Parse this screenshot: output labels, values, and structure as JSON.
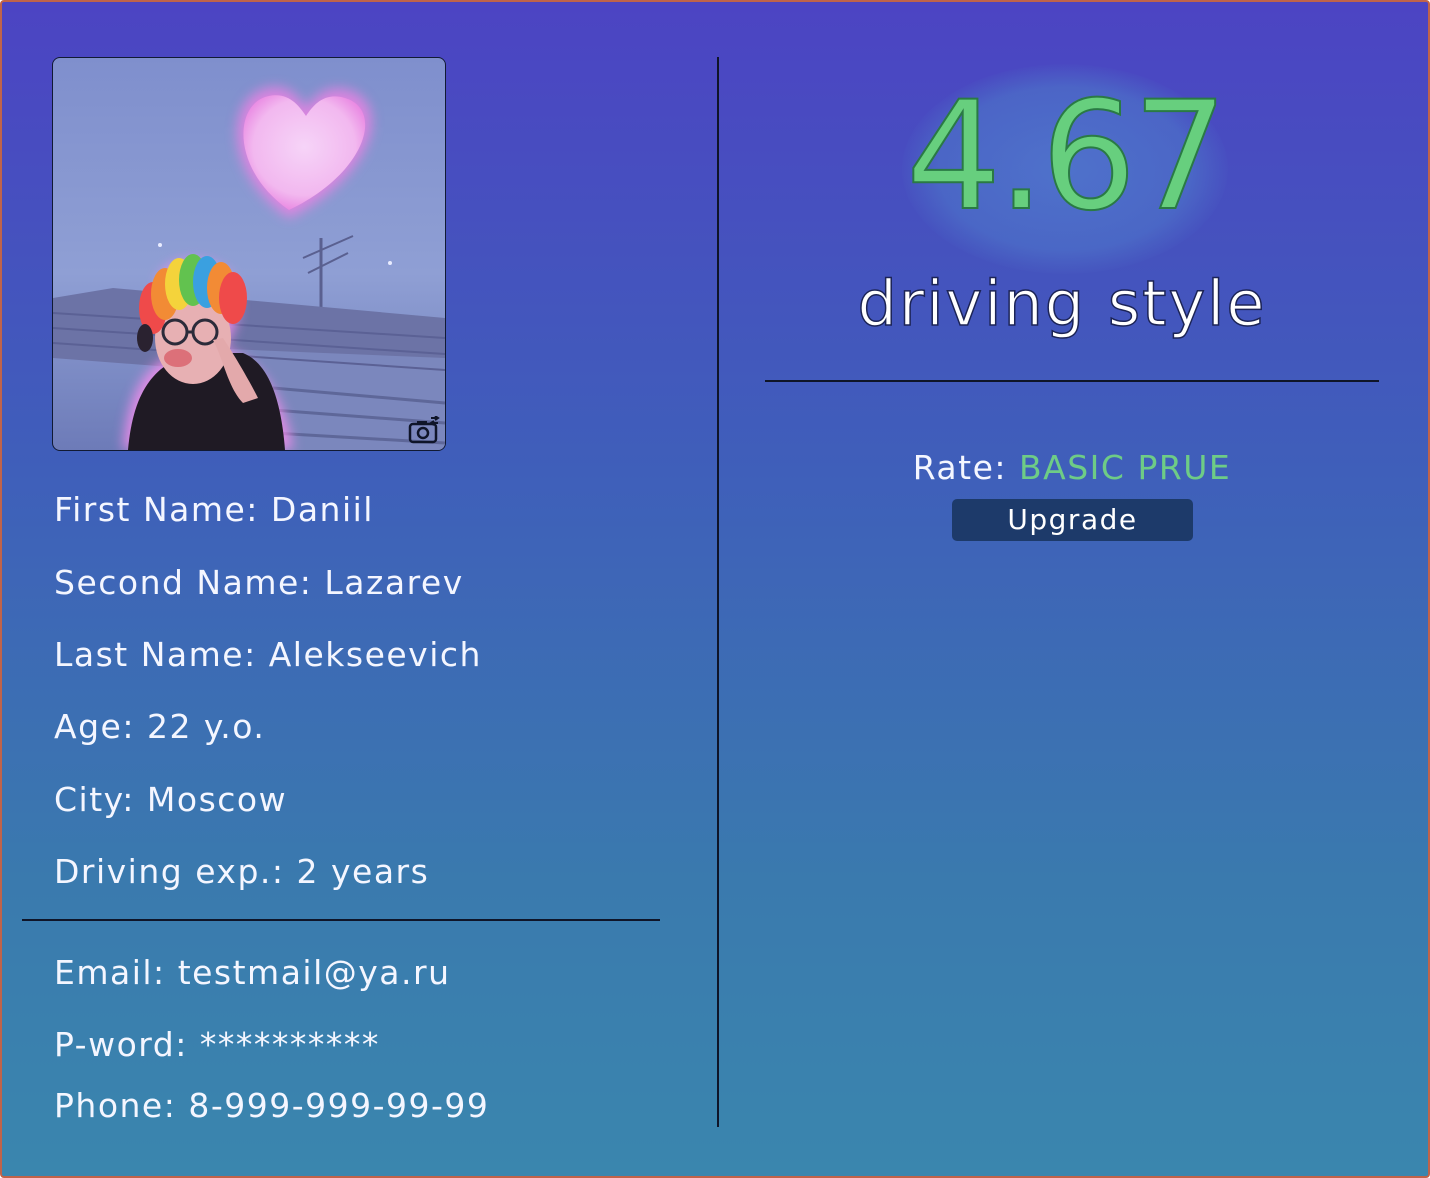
{
  "profile": {
    "avatar_alt": "profile photo",
    "fields": [
      {
        "label": "First Name:",
        "value": "Daniil"
      },
      {
        "label": "Second Name:",
        "value": "Lazarev"
      },
      {
        "label": "Last Name:",
        "value": "Alekseevich"
      },
      {
        "label": "Age:",
        "value": "22 y.o."
      },
      {
        "label": "City:",
        "value": "Moscow"
      },
      {
        "label": "Driving exp.:",
        "value": "2 years"
      }
    ],
    "account": [
      {
        "label": "Email:",
        "value": "testmail@ya.ru"
      },
      {
        "label": "P-word:",
        "value": "**********"
      },
      {
        "label": "Phone:",
        "value": "8-999-999-99-99"
      }
    ]
  },
  "score": {
    "value": "4.67",
    "caption": "driving style"
  },
  "rate": {
    "label": "Rate:",
    "plan": "BASIC PRUE",
    "upgrade_label": "Upgrade"
  },
  "icons": {
    "change_photo": "camera-switch-icon"
  },
  "colors": {
    "accent_green": "#67cf7e",
    "button_bg": "#1d3a6a",
    "gradient_top": "#4c44c3",
    "gradient_bottom": "#3a86ae"
  }
}
